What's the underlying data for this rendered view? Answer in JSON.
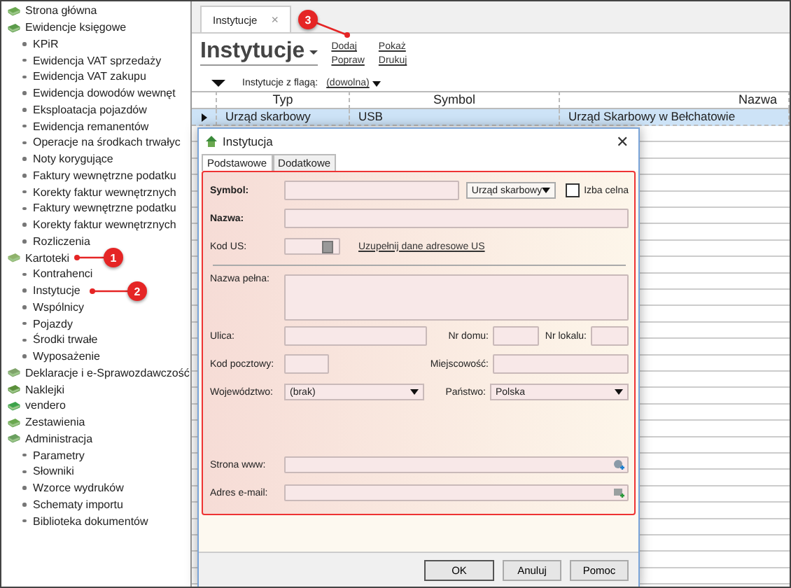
{
  "sidebar": {
    "items": [
      {
        "label": "Strona główna"
      },
      {
        "label": "Ewidencje księgowe",
        "children": [
          {
            "label": "KPiR"
          },
          {
            "label": "Ewidencja VAT sprzedaży"
          },
          {
            "label": "Ewidencja VAT zakupu"
          },
          {
            "label": "Ewidencja dowodów wewnęt"
          },
          {
            "label": "Eksploatacja pojazdów"
          },
          {
            "label": "Ewidencja remanentów"
          },
          {
            "label": "Operacje na środkach trwałyc"
          },
          {
            "label": "Noty korygujące"
          },
          {
            "label": "Faktury wewnętrzne podatku"
          },
          {
            "label": "Korekty faktur wewnętrznych"
          },
          {
            "label": "Faktury wewnętrzne podatku"
          },
          {
            "label": "Korekty faktur wewnętrznych"
          },
          {
            "label": "Rozliczenia"
          }
        ]
      },
      {
        "label": "Kartoteki",
        "children": [
          {
            "label": "Kontrahenci"
          },
          {
            "label": "Instytucje"
          },
          {
            "label": "Wspólnicy"
          },
          {
            "label": "Pojazdy"
          },
          {
            "label": "Środki trwałe"
          },
          {
            "label": "Wyposażenie"
          }
        ]
      },
      {
        "label": "Deklaracje i e-Sprawozdawczość"
      },
      {
        "label": "Naklejki"
      },
      {
        "label": "vendero"
      },
      {
        "label": "Zestawienia"
      },
      {
        "label": "Administracja",
        "children": [
          {
            "label": "Parametry"
          },
          {
            "label": "Słowniki"
          },
          {
            "label": "Wzorce wydruków"
          },
          {
            "label": "Schematy importu"
          },
          {
            "label": "Biblioteka dokumentów"
          }
        ]
      }
    ]
  },
  "tabs": [
    {
      "label": "Instytucje",
      "close": "×",
      "selected": true
    }
  ],
  "page": {
    "title": "Instytucje",
    "actions": [
      [
        "Dodaj",
        "Popraw"
      ],
      [
        "Pokaż",
        "Drukuj"
      ]
    ]
  },
  "filter": {
    "label": "Instytucje z flagą:",
    "value": "(dowolna)"
  },
  "table": {
    "columns": [
      "Typ",
      "Symbol",
      "Nazwa"
    ],
    "rows": [
      {
        "cells": [
          "Urząd skarbowy",
          "USB",
          "Urząd Skarbowy w Bełchatowie"
        ],
        "selected": true
      }
    ]
  },
  "dialog": {
    "title": "Instytucja",
    "close": "✕",
    "tabs": [
      {
        "label": "Podstawowe",
        "selected": true
      },
      {
        "label": "Dodatkowe",
        "selected": false
      }
    ],
    "form": {
      "symbol": {
        "label": "Symbol:",
        "required": true
      },
      "type": {
        "value": "Urząd skarbowy"
      },
      "izba_celna": {
        "label": "Izba celna",
        "checked": false
      },
      "nazwa": {
        "label": "Nazwa:",
        "required": true
      },
      "kod_us": {
        "label": "Kod US:",
        "required": false
      },
      "link": "Uzupełnij dane adresowe US",
      "nazwa_pelna": "Nazwa pełna:",
      "ulica": "Ulica:",
      "nr_domu": "Nr domu:",
      "nr_lokalu": "Nr lokalu:",
      "kod_pocztowy": "Kod pocztowy:",
      "miejscowosc": "Miejscowość:",
      "wojewodztwo": {
        "label": "Województwo:",
        "value": "(brak)"
      },
      "panstwo": {
        "label": "Państwo:",
        "value": "Polska"
      },
      "www": "Strona www:",
      "email": "Adres e-mail:"
    },
    "buttons": [
      "OK",
      "Anuluj",
      "Pomoc"
    ]
  },
  "callouts": [
    {
      "number": "1"
    },
    {
      "number": "2"
    },
    {
      "number": "3"
    }
  ]
}
